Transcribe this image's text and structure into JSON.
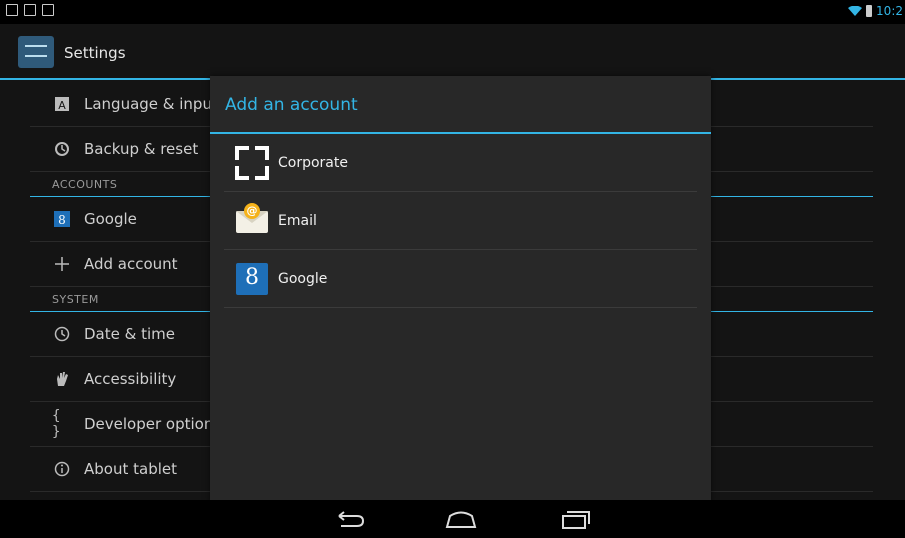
{
  "statusbar": {
    "time": "10:2"
  },
  "actionbar": {
    "title": "Settings"
  },
  "settings": {
    "items_top": [
      {
        "label": "Language & input",
        "icon": "keyboard-icon"
      },
      {
        "label": "Backup & reset",
        "icon": "backup-icon"
      }
    ],
    "accounts_header": "ACCOUNTS",
    "accounts": [
      {
        "label": "Google",
        "icon": "google-icon"
      },
      {
        "label": "Add account",
        "icon": "plus-icon"
      }
    ],
    "system_header": "SYSTEM",
    "system": [
      {
        "label": "Date & time",
        "icon": "clock-icon"
      },
      {
        "label": "Accessibility",
        "icon": "hand-icon"
      },
      {
        "label": "Developer options",
        "icon": "braces-icon"
      },
      {
        "label": "About tablet",
        "icon": "info-icon"
      }
    ]
  },
  "dialog": {
    "title": "Add an account",
    "accounts": [
      {
        "label": "Corporate",
        "icon": "corporate-icon"
      },
      {
        "label": "Email",
        "icon": "email-icon"
      },
      {
        "label": "Google",
        "icon": "google-icon"
      }
    ]
  },
  "colors": {
    "accent": "#33b5e5",
    "google": "#1e6fb8",
    "email": "#f5b21a"
  }
}
